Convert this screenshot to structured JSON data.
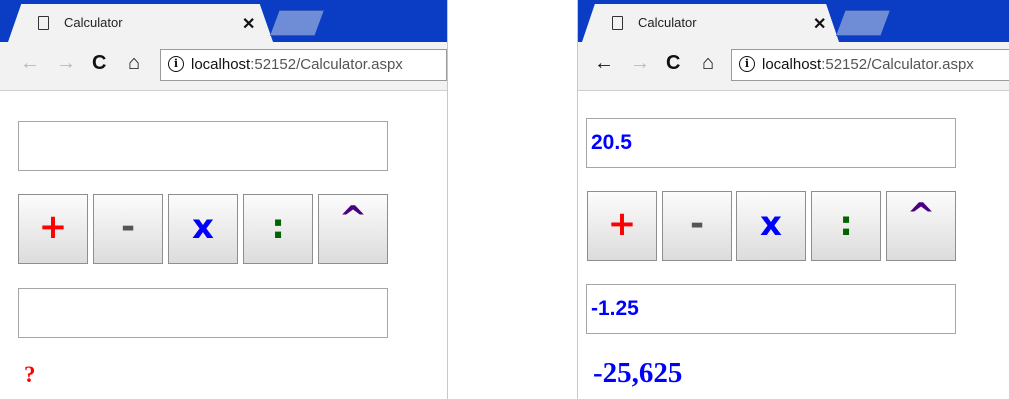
{
  "windows": [
    {
      "tab": {
        "title": "Calculator",
        "close": "✕"
      },
      "toolbar": {
        "back": "←",
        "forward": "→",
        "reload": "C",
        "home": "⌂",
        "info": "i"
      },
      "url": {
        "host": "localhost",
        "path": ":52152/Calculator.aspx"
      },
      "form": {
        "operand1": "",
        "operand2": "",
        "buttons": {
          "plus": "+",
          "minus": "-",
          "times": "x",
          "divide": ":",
          "power": "^"
        },
        "result": "?"
      }
    },
    {
      "tab": {
        "title": "Calculator",
        "close": "✕"
      },
      "toolbar": {
        "back": "←",
        "forward": "→",
        "reload": "C",
        "home": "⌂",
        "info": "i"
      },
      "url": {
        "host": "localhost",
        "path": ":52152/Calculator.aspx"
      },
      "form": {
        "operand1": "20.5",
        "operand2": "-1.25",
        "buttons": {
          "plus": "+",
          "minus": "-",
          "times": "x",
          "divide": ":",
          "power": "^"
        },
        "result": "-25,625"
      }
    }
  ],
  "colors": {
    "tabstrip": "#0a3dc4",
    "plus": "#ff0000",
    "minus": "#555555",
    "times": "#0000ff",
    "divide": "#006400",
    "power": "#4b0082",
    "input_text": "#0000ff",
    "result_unknown": "#ff0000",
    "result_value": "#0000ff"
  }
}
